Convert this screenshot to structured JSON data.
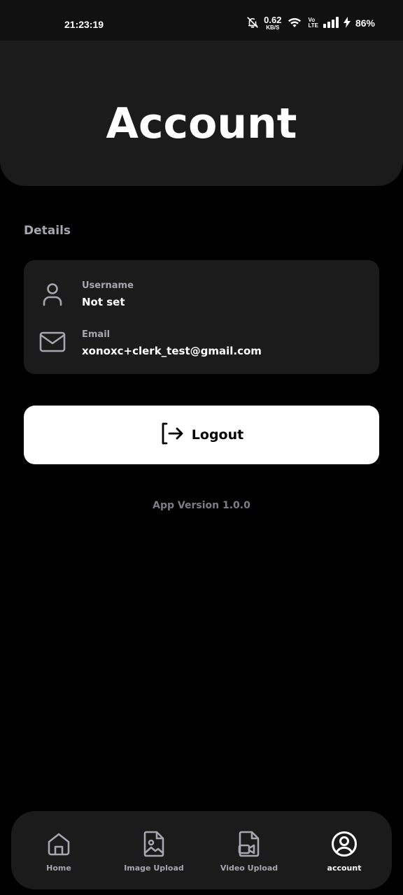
{
  "status_bar": {
    "time": "21:23:19",
    "net_speed_value": "0.62",
    "net_speed_unit": "KB/S",
    "volte_top": "Vo",
    "volte_bottom": "LTE",
    "battery": "86%"
  },
  "header": {
    "title": "Account"
  },
  "details": {
    "section_title": "Details",
    "username_label": "Username",
    "username_value": "Not set",
    "email_label": "Email",
    "email_value": "xonoxc+clerk_test@gmail.com"
  },
  "logout_label": "Logout",
  "app_version": "App Version 1.0.0",
  "bottom_nav": [
    {
      "label": "Home",
      "icon": "home-icon",
      "active": false
    },
    {
      "label": "Image Upload",
      "icon": "image-file-icon",
      "active": false
    },
    {
      "label": "Video Upload",
      "icon": "video-file-icon",
      "active": false
    },
    {
      "label": "account",
      "icon": "user-circle-icon",
      "active": true
    }
  ],
  "colors": {
    "background": "#000000",
    "card": "#1b1b1b",
    "muted_text": "#a6a6b0",
    "button_bg": "#ffffff"
  }
}
